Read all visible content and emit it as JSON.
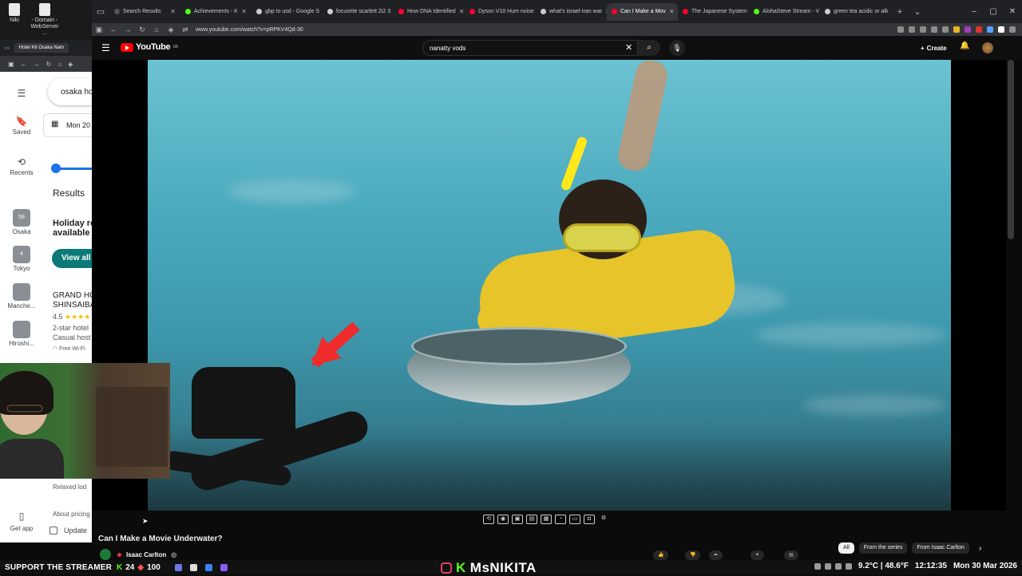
{
  "desktop": {
    "icons": [
      {
        "label": "Niki",
        "icon": "shortcut-icon"
      },
      {
        "label": "- Domain - WebServer ...",
        "icon": "document-icon"
      }
    ]
  },
  "browser": {
    "tabs": [
      {
        "label": "Search Results",
        "color": "#555555",
        "active": false
      },
      {
        "label": "Achievements - K",
        "color": "#53fc18",
        "active": false
      },
      {
        "label": "gbp to usd - Google S",
        "color": "#cccccc",
        "active": false
      },
      {
        "label": "focusrite scarlett 2i2 3",
        "color": "#cccccc",
        "active": false
      },
      {
        "label": "How DNA Identified",
        "color": "#ff0033",
        "active": false
      },
      {
        "label": "Dyson V10 Hum noise",
        "color": "#ff0033",
        "active": false
      },
      {
        "label": "what's israel-Iran war",
        "color": "#cccccc",
        "active": false
      },
      {
        "label": "Can I Make a Mov",
        "color": "#ff0033",
        "active": true
      },
      {
        "label": "The Japanese System",
        "color": "#ff0033",
        "active": false
      },
      {
        "label": "AlohaSteve Stream - V",
        "color": "#53fc18",
        "active": false
      },
      {
        "label": "green tea acidic or alk",
        "color": "#cccccc",
        "active": false
      }
    ],
    "url": "www.youtube.com/watch?v=pRPKV4Qd-30"
  },
  "youtube": {
    "logo": "YouTube",
    "country_code": "GB",
    "search_query": "nanatty vods",
    "create_label": "Create",
    "video_title": "Can I Make a Movie Underwater?",
    "channel_name": "Isaac Carlton",
    "chips": [
      "All",
      "From the series",
      "From Isaac Carlton"
    ]
  },
  "side_browser": {
    "tab_label": "Hotel K6 Osaka Nam",
    "rail": [
      {
        "label": "Saved",
        "glyph": "bookmark-icon"
      },
      {
        "label": "Recents",
        "glyph": "history-icon"
      },
      {
        "label": "Osaka",
        "badge": "59"
      },
      {
        "label": "Tokyo",
        "badge": "4"
      },
      {
        "label": "Manche..."
      },
      {
        "label": "Hiroshi..."
      }
    ],
    "search_value": "osaka ho",
    "date_value": "Mon 20",
    "results_label": "Results",
    "holiday_line1": "Holiday re",
    "holiday_line2": "available f",
    "view_all": "View all",
    "hotel_name_1": "GRAND HO",
    "hotel_name_2": "SHINSAIBA",
    "rating": "4.5",
    "stars": "★★★★",
    "hotel_class": "2-star hotel",
    "hotel_desc": "Casual host",
    "wifi": "Free Wi-Fi",
    "relaxed": "Relaxed lod",
    "about_pricing": "About pricing",
    "get_app": "Get app",
    "update_label": "Update"
  },
  "taskbar": {
    "support": "SUPPORT THE STREAMER",
    "kick_k": "K",
    "kick_count": "24",
    "bits_count": "100",
    "brand": "MsNIKITA",
    "weather": "9.2°C | 48.6°F",
    "time": "12:12:35",
    "date": "Mon 30 Mar 2026"
  }
}
